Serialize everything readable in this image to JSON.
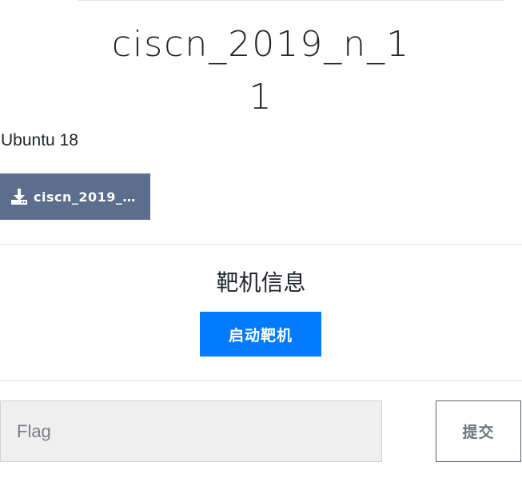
{
  "challenge": {
    "title_line1": "ciscn_2019_n_1",
    "title_line2": "1",
    "description": "Ubuntu 18",
    "download": {
      "label": "ciscn_2019_n...",
      "icon": "download-icon"
    }
  },
  "instance": {
    "section_title": "靶机信息",
    "start_label": "启动靶机"
  },
  "submission": {
    "flag_placeholder": "Flag",
    "flag_value": "",
    "submit_label": "提交"
  },
  "colors": {
    "download_button": "#5b6e8d",
    "start_button": "#007bff",
    "input_background": "#efefef"
  }
}
